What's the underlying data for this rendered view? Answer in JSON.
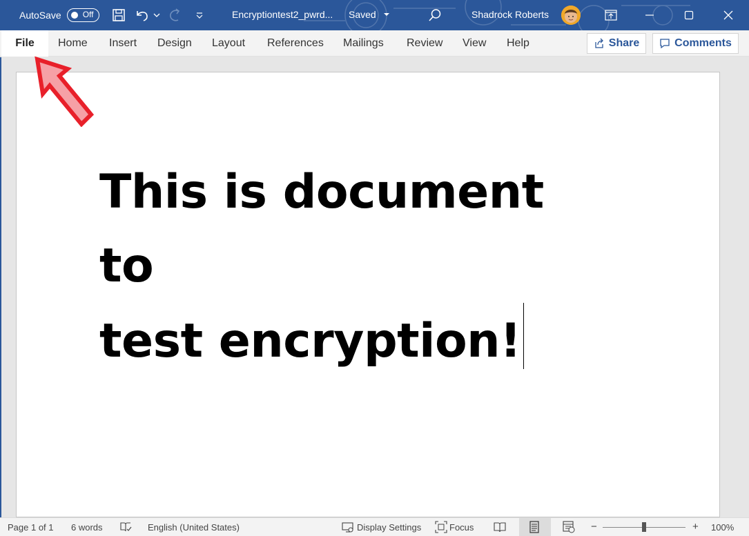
{
  "titlebar": {
    "autosave_label": "AutoSave",
    "autosave_state": "Off",
    "doc_title": "Encryptiontest2_pwrd...",
    "saved_status": "Saved",
    "user_name": "Shadrock Roberts",
    "bg_color": "#2b579a"
  },
  "ribbon": {
    "tabs": [
      "File",
      "Home",
      "Insert",
      "Design",
      "Layout",
      "References",
      "Mailings",
      "Review",
      "View",
      "Help"
    ],
    "share_label": "Share",
    "comments_label": "Comments"
  },
  "document": {
    "line1": "This is document to",
    "line2": "test encryption!"
  },
  "statusbar": {
    "page": "Page 1 of 1",
    "words": "6 words",
    "language": "English (United States)",
    "display_settings": "Display Settings",
    "focus": "Focus",
    "zoom": "100%",
    "zoom_minus": "−",
    "zoom_plus": "+"
  },
  "annotation": {
    "arrow_color": "#e8202a"
  }
}
